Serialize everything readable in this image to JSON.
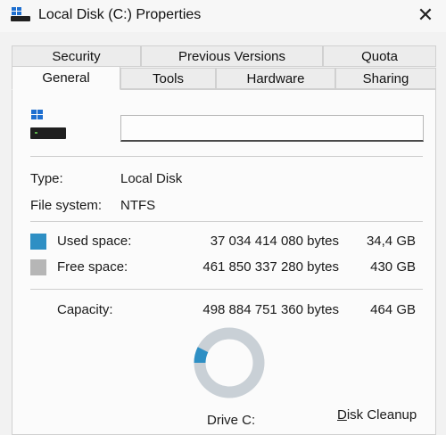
{
  "window": {
    "title": "Local Disk (C:) Properties",
    "close_glyph": "✕"
  },
  "tabs": {
    "row1": [
      "Security",
      "Previous Versions",
      "Quota"
    ],
    "row2": [
      "General",
      "Tools",
      "Hardware",
      "Sharing"
    ],
    "active": "General"
  },
  "general": {
    "drive_name_value": "",
    "type_label": "Type:",
    "type_value": "Local Disk",
    "fs_label": "File system:",
    "fs_value": "NTFS",
    "used": {
      "label": "Used space:",
      "bytes": "37 034 414 080 bytes",
      "short": "34,4 GB",
      "color": "#2e8fc4"
    },
    "free": {
      "label": "Free space:",
      "bytes": "461 850 337 280 bytes",
      "short": "430 GB",
      "color": "#b6b6b6"
    },
    "capacity": {
      "label": "Capacity:",
      "bytes": "498 884 751 360 bytes",
      "short": "464 GB"
    },
    "used_fraction": 0.074,
    "drive_label": "Drive C:",
    "cleanup": {
      "first": "D",
      "rest": "isk Cleanup"
    }
  },
  "icons": {
    "title": "drive-icon",
    "drive": "windows-drive-icon",
    "close": "close-icon"
  }
}
